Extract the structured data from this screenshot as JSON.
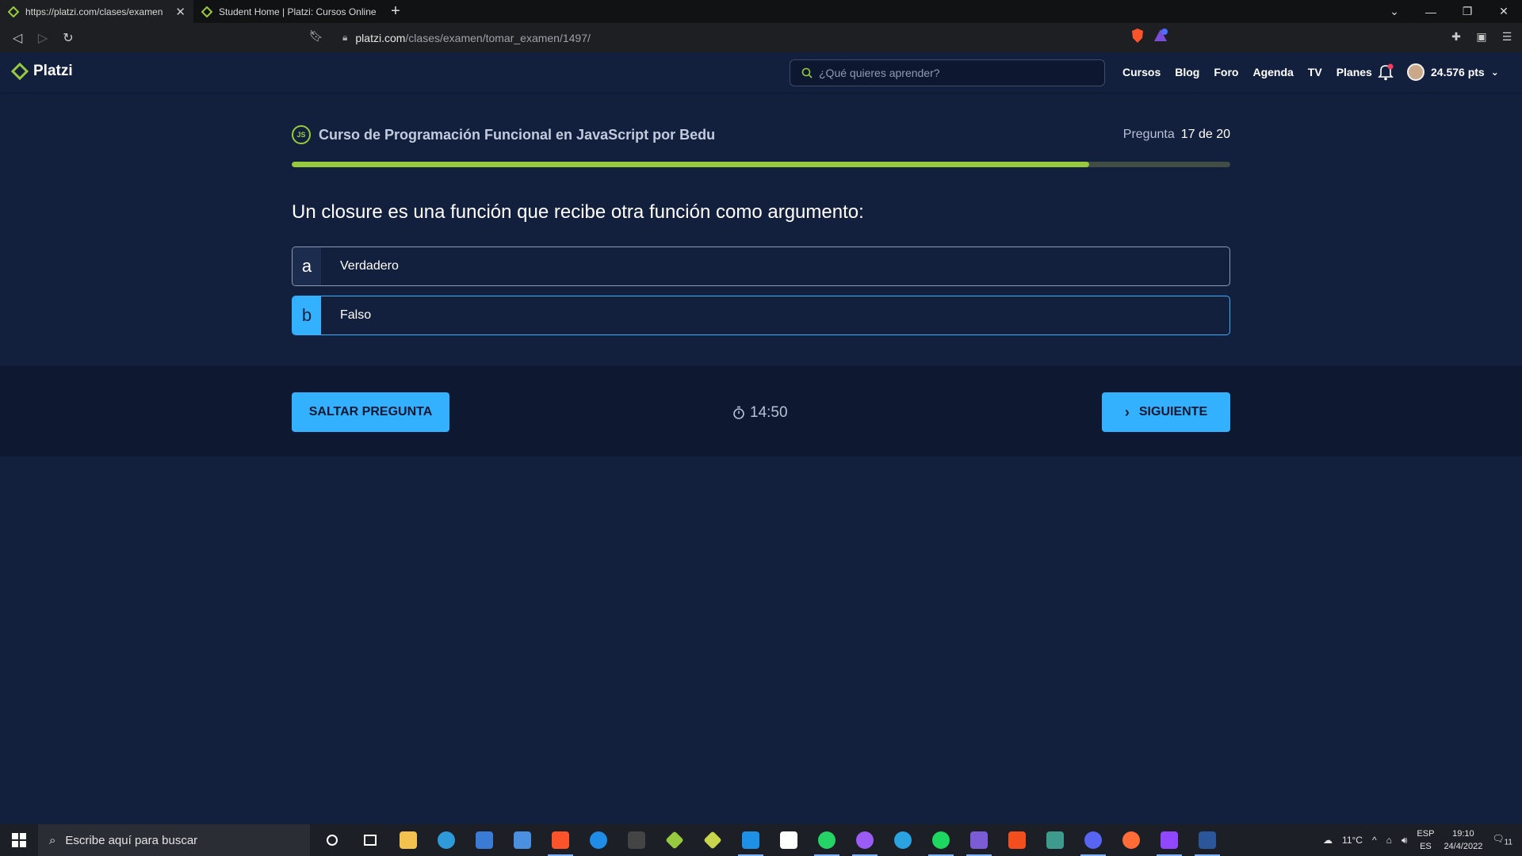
{
  "browser": {
    "tabs": [
      {
        "title": "https://platzi.com/clases/examen",
        "active": true
      },
      {
        "title": "Student Home | Platzi: Cursos Online F",
        "active": false
      }
    ],
    "url_domain": "platzi.com",
    "url_path": "/clases/examen/tomar_examen/1497/"
  },
  "header": {
    "logo": "Platzi",
    "search_placeholder": "¿Qué quieres aprender?",
    "nav": [
      "Cursos",
      "Blog",
      "Foro",
      "Agenda",
      "TV",
      "Planes"
    ],
    "points": "24.576 pts"
  },
  "exam": {
    "badge": "JS",
    "course_title": "Curso de Programación Funcional en JavaScript por Bedu",
    "counter_label": "Pregunta",
    "counter_value": "17 de 20",
    "progress_fraction": 0.85,
    "question": "Un closure es una función que recibe otra función como argumento:",
    "options": [
      {
        "letter": "a",
        "text": "Verdadero",
        "selected": false
      },
      {
        "letter": "b",
        "text": "Falso",
        "selected": true
      }
    ],
    "skip_label": "SALTAR PREGUNTA",
    "timer": "14:50",
    "next_label": "SIGUIENTE"
  },
  "taskbar": {
    "search_placeholder": "Escribe aquí para buscar",
    "weather": "11°C",
    "lang_top": "ESP",
    "lang_bottom": "ES",
    "time": "19:10",
    "date": "24/4/2022",
    "notif_count": "11"
  },
  "colors": {
    "accent": "#33b1ff",
    "progress": "#98ca3f",
    "background": "#13203d"
  }
}
